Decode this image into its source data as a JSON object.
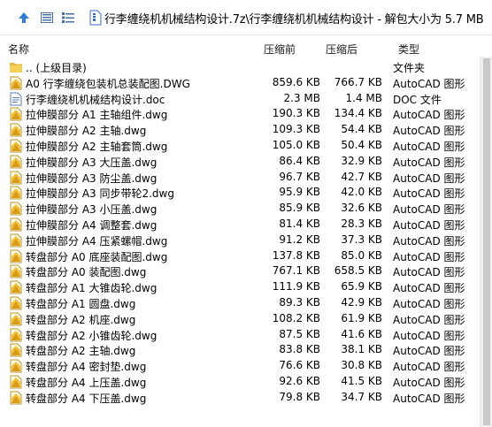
{
  "toolbar": {
    "address": "行李缠绕机机械结构设计.7z\\行李缠绕机机械结构设计 - 解包大小为 5.7 MB"
  },
  "columns": {
    "name": "名称",
    "compressed": "压缩前",
    "original": "压缩后",
    "type": "类型"
  },
  "files": [
    {
      "icon": "folder-up-icon",
      "name": ".. (上级目录)",
      "compressed": "",
      "original": "",
      "type": "文件夹"
    },
    {
      "icon": "dwg-file-icon",
      "name": "A0 行李缠绕包装机总装配图.DWG",
      "compressed": "859.6 KB",
      "original": "766.7 KB",
      "type": "AutoCAD 图形"
    },
    {
      "icon": "doc-file-icon",
      "name": "行李缠绕机机械结构设计.doc",
      "compressed": "2.3 MB",
      "original": "1.4 MB",
      "type": "DOC 文件"
    },
    {
      "icon": "dwg-file-icon",
      "name": "拉伸膜部分 A1 主轴组件.dwg",
      "compressed": "190.3 KB",
      "original": "134.4 KB",
      "type": "AutoCAD 图形"
    },
    {
      "icon": "dwg-file-icon",
      "name": "拉伸膜部分 A2 主轴.dwg",
      "compressed": "109.3 KB",
      "original": "54.4 KB",
      "type": "AutoCAD 图形"
    },
    {
      "icon": "dwg-file-icon",
      "name": "拉伸膜部分 A2 主轴套筒.dwg",
      "compressed": "105.0 KB",
      "original": "50.4 KB",
      "type": "AutoCAD 图形"
    },
    {
      "icon": "dwg-file-icon",
      "name": "拉伸膜部分 A3 大压盖.dwg",
      "compressed": "86.4 KB",
      "original": "32.9 KB",
      "type": "AutoCAD 图形"
    },
    {
      "icon": "dwg-file-icon",
      "name": "拉伸膜部分 A3 防尘盖.dwg",
      "compressed": "96.7 KB",
      "original": "42.7 KB",
      "type": "AutoCAD 图形"
    },
    {
      "icon": "dwg-file-icon",
      "name": "拉伸膜部分 A3 同步带轮2.dwg",
      "compressed": "95.9 KB",
      "original": "42.0 KB",
      "type": "AutoCAD 图形"
    },
    {
      "icon": "dwg-file-icon",
      "name": "拉伸膜部分 A3 小压盖.dwg",
      "compressed": "85.9 KB",
      "original": "32.6 KB",
      "type": "AutoCAD 图形"
    },
    {
      "icon": "dwg-file-icon",
      "name": "拉伸膜部分 A4 调整套.dwg",
      "compressed": "81.4 KB",
      "original": "28.3 KB",
      "type": "AutoCAD 图形"
    },
    {
      "icon": "dwg-file-icon",
      "name": "拉伸膜部分 A4 压紧螺帽.dwg",
      "compressed": "91.2 KB",
      "original": "37.3 KB",
      "type": "AutoCAD 图形"
    },
    {
      "icon": "dwg-file-icon",
      "name": "转盘部分 A0 底座装配图.dwg",
      "compressed": "137.8 KB",
      "original": "85.0 KB",
      "type": "AutoCAD 图形"
    },
    {
      "icon": "dwg-file-icon",
      "name": "转盘部分 A0 装配图.dwg",
      "compressed": "767.1 KB",
      "original": "658.5 KB",
      "type": "AutoCAD 图形"
    },
    {
      "icon": "dwg-file-icon",
      "name": "转盘部分 A1 大锥齿轮.dwg",
      "compressed": "111.9 KB",
      "original": "65.9 KB",
      "type": "AutoCAD 图形"
    },
    {
      "icon": "dwg-file-icon",
      "name": "转盘部分 A1 圆盘.dwg",
      "compressed": "89.3 KB",
      "original": "42.9 KB",
      "type": "AutoCAD 图形"
    },
    {
      "icon": "dwg-file-icon",
      "name": "转盘部分 A2 机座.dwg",
      "compressed": "108.2 KB",
      "original": "61.9 KB",
      "type": "AutoCAD 图形"
    },
    {
      "icon": "dwg-file-icon",
      "name": "转盘部分 A2 小锥齿轮.dwg",
      "compressed": "87.5 KB",
      "original": "41.6 KB",
      "type": "AutoCAD 图形"
    },
    {
      "icon": "dwg-file-icon",
      "name": "转盘部分 A2 主轴.dwg",
      "compressed": "83.8 KB",
      "original": "38.1 KB",
      "type": "AutoCAD 图形"
    },
    {
      "icon": "dwg-file-icon",
      "name": "转盘部分 A4 密封垫.dwg",
      "compressed": "76.6 KB",
      "original": "30.8 KB",
      "type": "AutoCAD 图形"
    },
    {
      "icon": "dwg-file-icon",
      "name": "转盘部分 A4 上压盖.dwg",
      "compressed": "92.6 KB",
      "original": "41.5 KB",
      "type": "AutoCAD 图形"
    },
    {
      "icon": "dwg-file-icon",
      "name": "转盘部分 A4 下压盖.dwg",
      "compressed": "79.8 KB",
      "original": "34.7 KB",
      "type": "AutoCAD 图形"
    }
  ]
}
